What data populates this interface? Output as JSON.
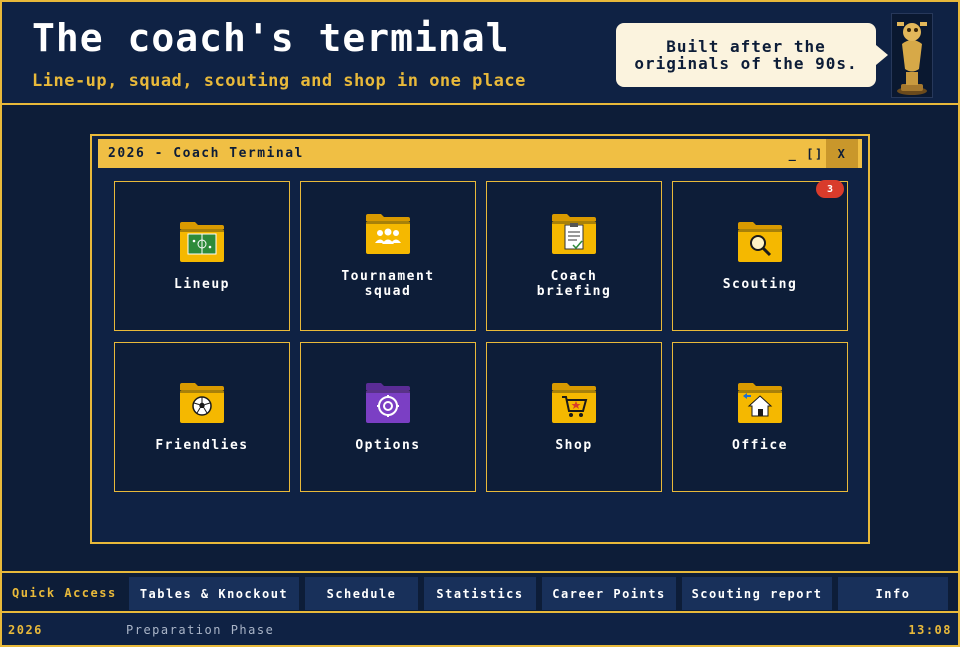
{
  "header": {
    "title": "The coach's terminal",
    "subtitle": "Line-up, squad, scouting and shop in one place",
    "bubble": "Built after the\noriginals of the 90s."
  },
  "window": {
    "title": "2026 - Coach Terminal",
    "min_label": "_",
    "max_label": "[]",
    "close_label": "X"
  },
  "tiles": [
    {
      "label": "Lineup",
      "icon": "lineup-field-icon"
    },
    {
      "label": "Tournament\nsquad",
      "icon": "squad-people-icon"
    },
    {
      "label": "Coach\nbriefing",
      "icon": "clipboard-icon"
    },
    {
      "label": "Scouting",
      "icon": "magnifier-icon",
      "badge": "3"
    },
    {
      "label": "Friendlies",
      "icon": "soccer-ball-icon"
    },
    {
      "label": "Options",
      "icon": "gear-icon"
    },
    {
      "label": "Shop",
      "icon": "shopping-cart-icon"
    },
    {
      "label": "Office",
      "icon": "home-icon"
    }
  ],
  "quick_access": {
    "label": "Quick Access",
    "buttons": [
      "Tables & Knockout",
      "Schedule",
      "Statistics",
      "Career Points",
      "Scouting report",
      "Info"
    ]
  },
  "status": {
    "year": "2026",
    "phase": "Preparation Phase",
    "time": "13:08"
  },
  "colors": {
    "accent": "#e8b93a",
    "background": "#0d1d38",
    "folder": "#f5b800",
    "folder_options": "#7b3fc4",
    "badge": "#d93b2b"
  }
}
